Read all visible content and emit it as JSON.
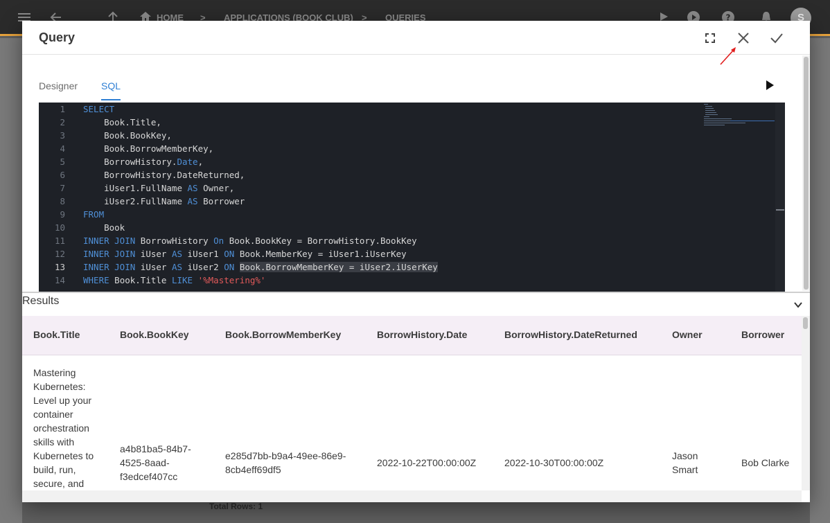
{
  "breadcrumb": {
    "home": "HOME",
    "applications": "APPLICATIONS (BOOK CLUB)",
    "queries": "QUERIES"
  },
  "user": {
    "avatar_letter": "S"
  },
  "background": {
    "total_rows": "Total Rows: 1"
  },
  "dialog": {
    "title": "Query",
    "tabs": [
      {
        "label": "Designer",
        "active": false
      },
      {
        "label": "SQL",
        "active": true
      }
    ]
  },
  "editor": {
    "line_numbers": [
      "1",
      "2",
      "3",
      "4",
      "5",
      "6",
      "7",
      "8",
      "9",
      "10",
      "11",
      "12",
      "13",
      "14"
    ],
    "active_line": 13,
    "lines": [
      [
        {
          "t": "SELECT",
          "c": "kw"
        }
      ],
      [
        {
          "t": "    Book.Title,"
        }
      ],
      [
        {
          "t": "    Book.BookKey,"
        }
      ],
      [
        {
          "t": "    Book.BorrowMemberKey,"
        }
      ],
      [
        {
          "t": "    BorrowHistory."
        },
        {
          "t": "Date",
          "c": "kw"
        },
        {
          "t": ","
        }
      ],
      [
        {
          "t": "    BorrowHistory.DateReturned,"
        }
      ],
      [
        {
          "t": "    iUser1.FullName "
        },
        {
          "t": "AS",
          "c": "kw"
        },
        {
          "t": " Owner,"
        }
      ],
      [
        {
          "t": "    iUser2.FullName "
        },
        {
          "t": "AS",
          "c": "kw"
        },
        {
          "t": " Borrower"
        }
      ],
      [
        {
          "t": "FROM",
          "c": "kw"
        }
      ],
      [
        {
          "t": "    Book"
        }
      ],
      [
        {
          "t": "INNER JOIN",
          "c": "kw"
        },
        {
          "t": " BorrowHistory "
        },
        {
          "t": "On",
          "c": "kw"
        },
        {
          "t": " Book.BookKey = BorrowHistory.BookKey"
        }
      ],
      [
        {
          "t": "INNER JOIN",
          "c": "kw"
        },
        {
          "t": " iUser "
        },
        {
          "t": "AS",
          "c": "kw"
        },
        {
          "t": " iUser1 "
        },
        {
          "t": "ON",
          "c": "kw"
        },
        {
          "t": " Book.MemberKey = iUser1.iUserKey"
        }
      ],
      [
        {
          "t": "INNER JOIN",
          "c": "kw"
        },
        {
          "t": " iUser "
        },
        {
          "t": "AS",
          "c": "kw"
        },
        {
          "t": " iUser2 "
        },
        {
          "t": "ON",
          "c": "kw"
        },
        {
          "t": " "
        },
        {
          "t": "Book.BorrowMemberKey = iUser2.iUserKey",
          "c": "hl"
        }
      ],
      [
        {
          "t": "WHERE",
          "c": "kw"
        },
        {
          "t": " Book.Title "
        },
        {
          "t": "LIKE",
          "c": "kw"
        },
        {
          "t": " "
        },
        {
          "t": "'%Mastering%'",
          "c": "str"
        }
      ]
    ]
  },
  "results": {
    "label": "Results",
    "columns": [
      "Book.Title",
      "Book.BookKey",
      "Book.BorrowMemberKey",
      "BorrowHistory.Date",
      "BorrowHistory.DateReturned",
      "Owner",
      "Borrower"
    ],
    "rows": [
      {
        "title_lines": [
          "Mastering",
          "Kubernetes:",
          "Level up your",
          "container",
          "orchestration",
          "skills with",
          "Kubernetes to",
          "build, run,",
          "secure, and"
        ],
        "bookkey_lines": [
          "a4b81ba5-84b7-",
          "4525-8aad-",
          "f3edcef407cc"
        ],
        "borrowmemberkey_lines": [
          "e285d7bb-b9a4-49ee-86e9-",
          "8cb4eff69df5"
        ],
        "date": "2022-10-22T00:00:00Z",
        "date_returned": "2022-10-30T00:00:00Z",
        "owner_lines": [
          "Jason",
          "Smart"
        ],
        "borrower": "Bob Clarke"
      }
    ]
  }
}
